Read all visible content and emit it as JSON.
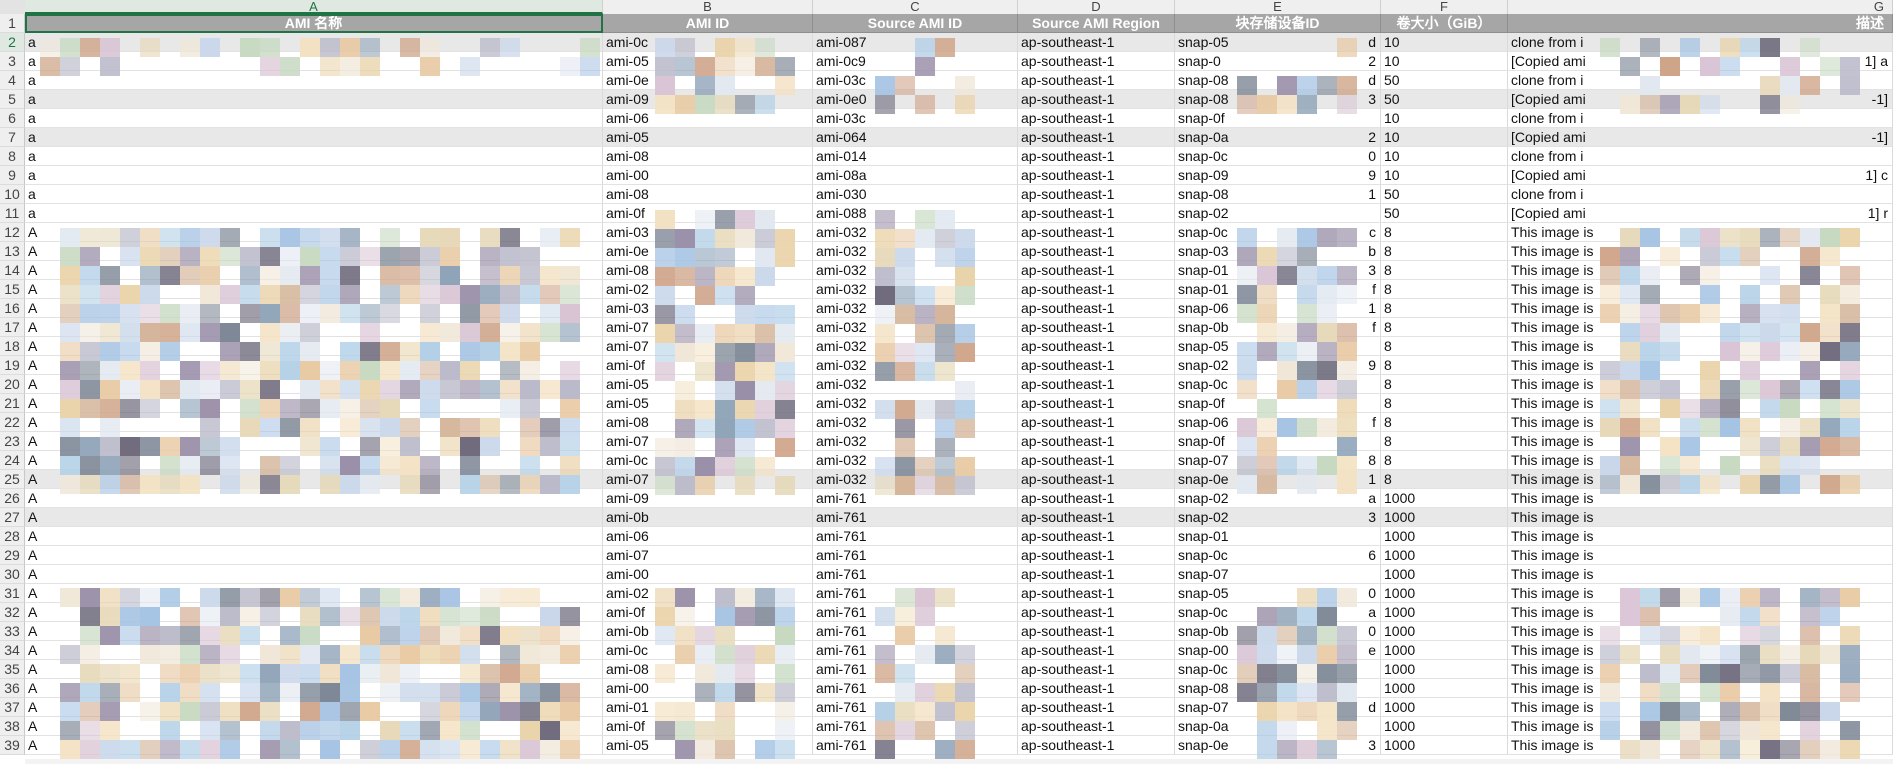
{
  "spreadsheet": {
    "column_letters": [
      "A",
      "B",
      "C",
      "D",
      "E",
      "F",
      "G"
    ],
    "header": {
      "row_number": "1",
      "cells": [
        "AMI 名称",
        "AMI ID",
        "Source AMI ID",
        "Source AMI Region",
        "块存储设备ID",
        "卷大小（GiB）",
        "描述"
      ]
    },
    "rows": [
      {
        "n": "2",
        "a": "a",
        "b": "ami-0c",
        "c": "ami-087",
        "d": "ap-southeast-1",
        "e": "snap-05",
        "e2": "d",
        "f": "10",
        "g": "clone from i",
        "g2": ""
      },
      {
        "n": "3",
        "a": "a",
        "b": "ami-05",
        "c": "ami-0c9",
        "d": "ap-southeast-1",
        "e": "snap-0",
        "e2": "2",
        "f": "10",
        "g": "[Copied ami",
        "g2": "1] a"
      },
      {
        "n": "4",
        "a": "a",
        "b": "ami-0e",
        "c": "ami-03c",
        "d": "ap-southeast-1",
        "e": "snap-08",
        "e2": "d",
        "f": "50",
        "g": "clone from i",
        "g2": ""
      },
      {
        "n": "5",
        "a": "a",
        "b": "ami-09",
        "c": "ami-0e0",
        "d": "ap-southeast-1",
        "e": "snap-08",
        "e2": "3",
        "f": "50",
        "g": "[Copied ami",
        "g2": "-1]"
      },
      {
        "n": "6",
        "a": "a",
        "b": "ami-06",
        "c": "ami-03c",
        "d": "ap-southeast-1",
        "e": "snap-0f",
        "e2": "",
        "f": "10",
        "g": "clone from i",
        "g2": ""
      },
      {
        "n": "7",
        "a": "a",
        "b": "ami-05",
        "c": "ami-064",
        "d": "ap-southeast-1",
        "e": "snap-0a",
        "e2": "2",
        "f": "10",
        "g": "[Copied ami",
        "g2": "-1]"
      },
      {
        "n": "8",
        "a": "a",
        "b": "ami-08",
        "c": "ami-014",
        "d": "ap-southeast-1",
        "e": "snap-0c",
        "e2": "0",
        "f": "10",
        "g": "clone from i",
        "g2": ""
      },
      {
        "n": "9",
        "a": "a",
        "b": "ami-00",
        "c": "ami-08a",
        "d": "ap-southeast-1",
        "e": "snap-09",
        "e2": "9",
        "f": "10",
        "g": "[Copied ami",
        "g2": "1] c"
      },
      {
        "n": "10",
        "a": "a",
        "b": "ami-08",
        "c": "ami-030",
        "d": "ap-southeast-1",
        "e": "snap-08",
        "e2": "1",
        "f": "50",
        "g": "clone from i",
        "g2": ""
      },
      {
        "n": "11",
        "a": "a",
        "b": "ami-0f",
        "c": "ami-088",
        "d": "ap-southeast-1",
        "e": "snap-02",
        "e2": "",
        "f": "50",
        "g": "[Copied ami",
        "g2": "1] r"
      },
      {
        "n": "12",
        "a": "A",
        "b": "ami-03",
        "c": "ami-032",
        "d": "ap-southeast-1",
        "e": "snap-0c",
        "e2": "c",
        "f": "8",
        "g": "This image is",
        "g2": ""
      },
      {
        "n": "13",
        "a": "A",
        "b": "ami-0e",
        "c": "ami-032",
        "d": "ap-southeast-1",
        "e": "snap-03",
        "e2": "b",
        "f": "8",
        "g": "This image is",
        "g2": ""
      },
      {
        "n": "14",
        "a": "A",
        "b": "ami-08",
        "c": "ami-032",
        "d": "ap-southeast-1",
        "e": "snap-01",
        "e2": "3",
        "f": "8",
        "g": "This image is",
        "g2": ""
      },
      {
        "n": "15",
        "a": "A",
        "b": "ami-02",
        "c": "ami-032",
        "d": "ap-southeast-1",
        "e": "snap-01",
        "e2": "f",
        "f": "8",
        "g": "This image is",
        "g2": ""
      },
      {
        "n": "16",
        "a": "A",
        "b": "ami-03",
        "c": "ami-032",
        "d": "ap-southeast-1",
        "e": "snap-06",
        "e2": "1",
        "f": "8",
        "g": "This image is",
        "g2": ""
      },
      {
        "n": "17",
        "a": "A",
        "b": "ami-07",
        "c": "ami-032",
        "d": "ap-southeast-1",
        "e": "snap-0b",
        "e2": "f",
        "f": "8",
        "g": "This image is",
        "g2": ""
      },
      {
        "n": "18",
        "a": "A",
        "b": "ami-07",
        "c": "ami-032",
        "d": "ap-southeast-1",
        "e": "snap-05",
        "e2": "",
        "f": "8",
        "g": "This image is",
        "g2": ""
      },
      {
        "n": "19",
        "a": "A",
        "b": "ami-0f",
        "c": "ami-032",
        "d": "ap-southeast-1",
        "e": "snap-02",
        "e2": "9",
        "f": "8",
        "g": "This image is",
        "g2": ""
      },
      {
        "n": "20",
        "a": "A",
        "b": "ami-05",
        "c": "ami-032",
        "d": "ap-southeast-1",
        "e": "snap-0c",
        "e2": "",
        "f": "8",
        "g": "This image is",
        "g2": ""
      },
      {
        "n": "21",
        "a": "A",
        "b": "ami-05",
        "c": "ami-032",
        "d": "ap-southeast-1",
        "e": "snap-0f",
        "e2": "",
        "f": "8",
        "g": "This image is",
        "g2": ""
      },
      {
        "n": "22",
        "a": "A",
        "b": "ami-08",
        "c": "ami-032",
        "d": "ap-southeast-1",
        "e": "snap-06",
        "e2": "f",
        "f": "8",
        "g": "This image is",
        "g2": ""
      },
      {
        "n": "23",
        "a": "A",
        "b": "ami-07",
        "c": "ami-032",
        "d": "ap-southeast-1",
        "e": "snap-0f",
        "e2": "",
        "f": "8",
        "g": "This image is",
        "g2": ""
      },
      {
        "n": "24",
        "a": "A",
        "b": "ami-0c",
        "c": "ami-032",
        "d": "ap-southeast-1",
        "e": "snap-07",
        "e2": "8",
        "f": "8",
        "g": "This image is",
        "g2": ""
      },
      {
        "n": "25",
        "a": "A",
        "b": "ami-07",
        "c": "ami-032",
        "d": "ap-southeast-1",
        "e": "snap-0e",
        "e2": "1",
        "f": "8",
        "g": "This image is",
        "g2": ""
      },
      {
        "n": "26",
        "a": "A",
        "b": "ami-09",
        "c": "ami-761",
        "d": "ap-southeast-1",
        "e": "snap-02",
        "e2": "a",
        "f": "1000",
        "g": "This image is",
        "g2": ""
      },
      {
        "n": "27",
        "a": "A",
        "b": "ami-0b",
        "c": "ami-761",
        "d": "ap-southeast-1",
        "e": "snap-02",
        "e2": "3",
        "f": "1000",
        "g": "This image is",
        "g2": ""
      },
      {
        "n": "28",
        "a": "A",
        "b": "ami-06",
        "c": "ami-761",
        "d": "ap-southeast-1",
        "e": "snap-01",
        "e2": "",
        "f": "1000",
        "g": "This image is",
        "g2": ""
      },
      {
        "n": "29",
        "a": "A",
        "b": "ami-07",
        "c": "ami-761",
        "d": "ap-southeast-1",
        "e": "snap-0c",
        "e2": "6",
        "f": "1000",
        "g": "This image is",
        "g2": ""
      },
      {
        "n": "30",
        "a": "A",
        "b": "ami-00",
        "c": "ami-761",
        "d": "ap-southeast-1",
        "e": "snap-07",
        "e2": "",
        "f": "1000",
        "g": "This image is",
        "g2": ""
      },
      {
        "n": "31",
        "a": "A",
        "b": "ami-02",
        "c": "ami-761",
        "d": "ap-southeast-1",
        "e": "snap-05",
        "e2": "0",
        "f": "1000",
        "g": "This image is",
        "g2": ""
      },
      {
        "n": "32",
        "a": "A",
        "b": "ami-0f",
        "c": "ami-761",
        "d": "ap-southeast-1",
        "e": "snap-0c",
        "e2": "a",
        "f": "1000",
        "g": "This image is",
        "g2": ""
      },
      {
        "n": "33",
        "a": "A",
        "b": "ami-0b",
        "c": "ami-761",
        "d": "ap-southeast-1",
        "e": "snap-0b",
        "e2": "0",
        "f": "1000",
        "g": "This image is",
        "g2": ""
      },
      {
        "n": "34",
        "a": "A",
        "b": "ami-0c",
        "c": "ami-761",
        "d": "ap-southeast-1",
        "e": "snap-00",
        "e2": "e",
        "f": "1000",
        "g": "This image is",
        "g2": ""
      },
      {
        "n": "35",
        "a": "A",
        "b": "ami-08",
        "c": "ami-761",
        "d": "ap-southeast-1",
        "e": "snap-0c",
        "e2": "",
        "f": "1000",
        "g": "This image is",
        "g2": ""
      },
      {
        "n": "36",
        "a": "A",
        "b": "ami-00",
        "c": "ami-761",
        "d": "ap-southeast-1",
        "e": "snap-08",
        "e2": "",
        "f": "1000",
        "g": "This image is",
        "g2": ""
      },
      {
        "n": "37",
        "a": "A",
        "b": "ami-01",
        "c": "ami-761",
        "d": "ap-southeast-1",
        "e": "snap-07",
        "e2": "d",
        "f": "1000",
        "g": "This image is",
        "g2": ""
      },
      {
        "n": "38",
        "a": "A",
        "b": "ami-0f",
        "c": "ami-761",
        "d": "ap-southeast-1",
        "e": "snap-0a",
        "e2": "",
        "f": "1000",
        "g": "This image is",
        "g2": ""
      },
      {
        "n": "39",
        "a": "A",
        "b": "ami-05",
        "c": "ami-761",
        "d": "ap-southeast-1",
        "e": "snap-0e",
        "e2": "3",
        "f": "1000",
        "g": "This image is",
        "g2": ""
      }
    ],
    "shaded_rows": [
      "2",
      "5",
      "7",
      "25",
      "27"
    ],
    "colors": {
      "header_bg": "#a6a6a6",
      "header_text": "#ffffff",
      "selection_accent": "#217346",
      "shaded_row": "#e8e8e8"
    },
    "redaction_palette": [
      "#c9d7ea",
      "#a5c3e3",
      "#e8c9a3",
      "#f3e1c2",
      "#b9b9c9",
      "#d9c4d4",
      "#8fa3b8",
      "#c7d9c1",
      "#e6d8b8",
      "#9a8fa8",
      "#f0e7d8",
      "#b2cfe6",
      "#d4b59a",
      "#7d8795",
      "#e2e8f0",
      "#cfa58a",
      "#6e6a7c",
      "#e9d2a8"
    ]
  }
}
